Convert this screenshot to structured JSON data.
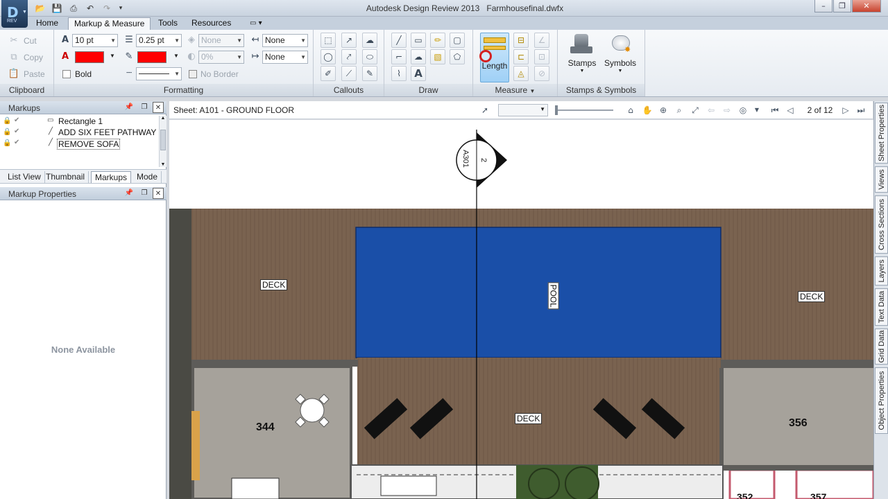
{
  "app": {
    "title": "Autodesk Design Review 2013",
    "document": "Farmhousefinal.dwfx",
    "logo_letter": "D",
    "logo_sub": "REV"
  },
  "tabs": [
    "Home",
    "Markup & Measure",
    "Tools",
    "Resources"
  ],
  "active_tab": "Markup & Measure",
  "ribbon": {
    "clipboard": {
      "label": "Clipboard",
      "cut": "Cut",
      "copy": "Copy",
      "paste": "Paste"
    },
    "formatting": {
      "label": "Formatting",
      "font_size": "10 pt",
      "line_weight": "0.25 pt",
      "fill_none": "None",
      "transparency": "0%",
      "start_arrow": "None",
      "end_arrow": "None",
      "bold": "Bold",
      "no_border": "No Border",
      "line_color": "#ff0000",
      "fill_color": "#ff0000"
    },
    "callouts": {
      "label": "Callouts"
    },
    "draw": {
      "label": "Draw"
    },
    "measure": {
      "label": "Measure",
      "length": "Length"
    },
    "stamps_symbols": {
      "label": "Stamps & Symbols",
      "stamps": "Stamps",
      "symbols": "Symbols"
    }
  },
  "markups_pane": {
    "title": "Markups",
    "items": [
      "Rectangle 1",
      "ADD SIX FEET PATHWAY",
      "REMOVE SOFA"
    ]
  },
  "left_tabs": [
    "List View",
    "Thumbnail",
    "Markups",
    "Mode"
  ],
  "active_left_tab": "Markups",
  "properties_pane": {
    "title": "Markup Properties",
    "empty_text": "None Available"
  },
  "sheet": {
    "name": "Sheet: A101 - GROUND FLOOR",
    "page": "2 of 12"
  },
  "drawing": {
    "section_tag_sheet": "A301",
    "section_tag_number": "2",
    "labels": [
      "DECK",
      "POOL",
      "DECK",
      "DECK"
    ],
    "rooms": [
      "344",
      "356",
      "352",
      "357"
    ],
    "colors": {
      "deck": "#7a6350",
      "pool": "#1a4fa8",
      "floor": "#a6a29b",
      "wall": "#5d5c59"
    }
  },
  "right_tabs": [
    "Sheet Properties",
    "Views",
    "Cross Sections",
    "Layers",
    "Text Data",
    "Grid Data",
    "Object Properties"
  ]
}
